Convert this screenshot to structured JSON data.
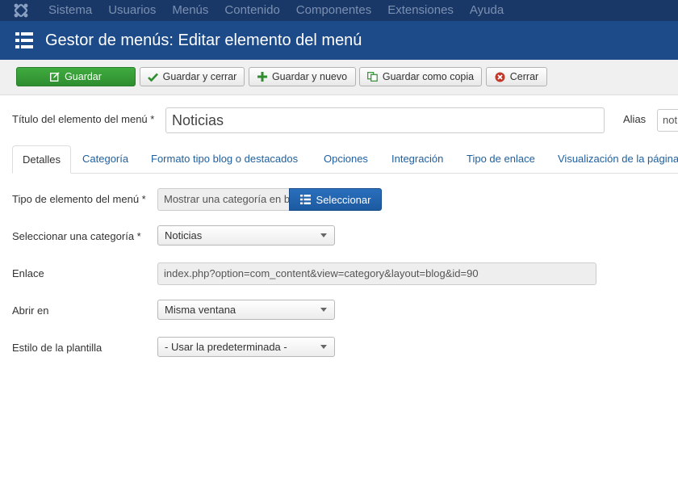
{
  "navbar": {
    "logo_icon": "joomla-logo-icon",
    "items": [
      "Sistema",
      "Usuarios",
      "Menús",
      "Contenido",
      "Componentes",
      "Extensiones",
      "Ayuda"
    ]
  },
  "header": {
    "icon": "list-icon",
    "title": "Gestor de menús: Editar elemento del menú"
  },
  "toolbar": {
    "save_label": "Guardar",
    "save_close_label": "Guardar y cerrar",
    "save_new_label": "Guardar y nuevo",
    "save_copy_label": "Guardar como copia",
    "close_label": "Cerrar"
  },
  "title_row": {
    "title_label": "Título del elemento del menú *",
    "title_value": "Noticias",
    "alias_label": "Alias",
    "alias_value": "noticias"
  },
  "tabs": [
    "Detalles",
    "Categoría",
    "Formato tipo blog o destacados",
    "Opciones",
    "Integración",
    "Tipo de enlace",
    "Visualización de la página"
  ],
  "form": {
    "type_label": "Tipo de elemento del menú *",
    "type_value": "Mostrar una categoría en blog",
    "select_button": "Seleccionar",
    "category_label": "Seleccionar una categoría *",
    "category_value": "Noticias",
    "link_label": "Enlace",
    "link_value": "index.php?option=com_content&view=category&layout=blog&id=90",
    "open_label": "Abrir en",
    "open_value": "Misma ventana",
    "template_label": "Estilo de la plantilla",
    "template_value": "- Usar la predeterminada -"
  },
  "colors": {
    "navbar_bg": "#1a3867",
    "header_bg": "#1d4a88",
    "success": "#2f8d2f",
    "primary": "#1c5aa0",
    "link": "#1f5f9e"
  }
}
